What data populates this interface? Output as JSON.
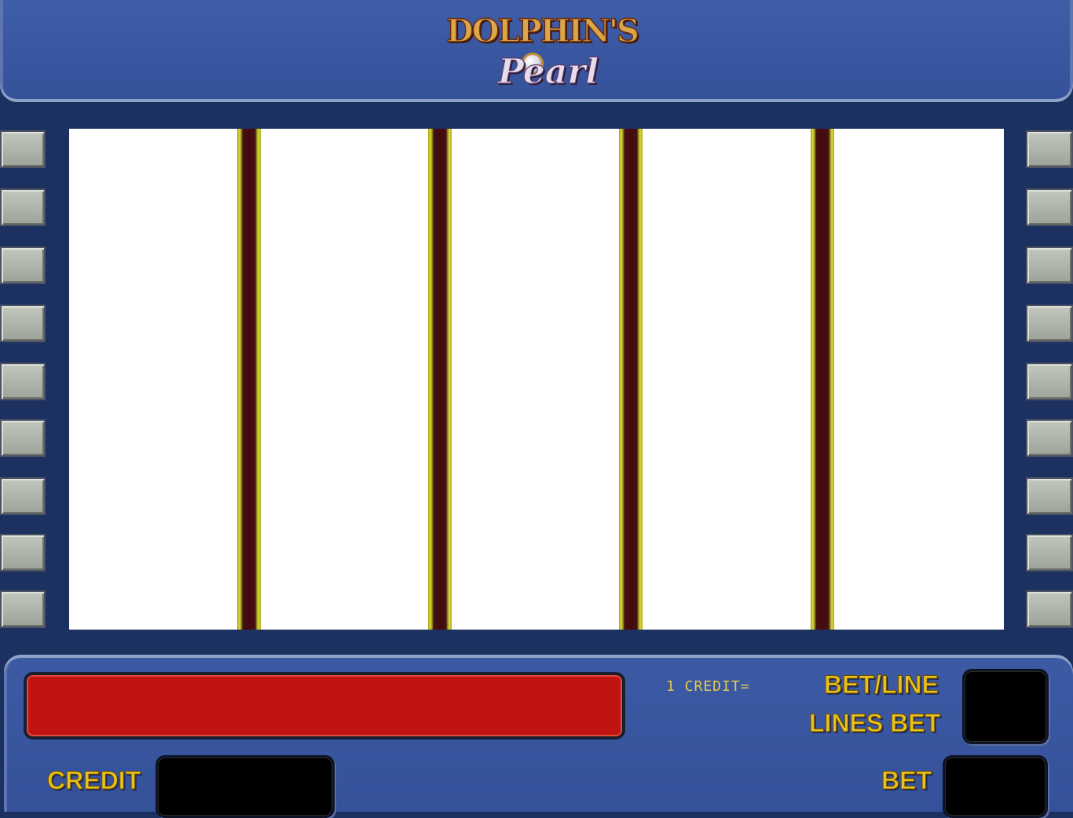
{
  "game": {
    "title_line1": "DOLPHIN'S",
    "title_line2": "Pearl"
  },
  "colors": {
    "background": "#1d3160",
    "panel": "#34519a",
    "reel": "#ffffff",
    "message_bar": "#c21313",
    "label_gold": "#e8c21e",
    "separator_gold": "#e0dc3a",
    "separator_maroon": "#3e0b0e"
  },
  "left_buttons_count": 9,
  "right_buttons_count": 9,
  "reels_count": 5,
  "info": {
    "credit_rate_label": "1 CREDIT=",
    "bet_line_label": "BET/LINE",
    "lines_bet_label": "LINES BET",
    "credit_label": "CREDIT",
    "bet_label": "BET"
  }
}
